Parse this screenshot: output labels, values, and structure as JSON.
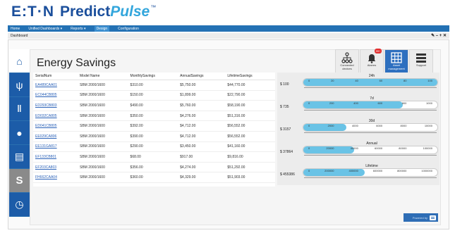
{
  "brand": {
    "company": "E:T·N",
    "product_a": "Predict",
    "product_b": "Pulse",
    "tm": "™"
  },
  "nav": {
    "items": [
      {
        "label": "Home",
        "active": false
      },
      {
        "label": "Unified Dashboards ▾",
        "active": false
      },
      {
        "label": "Reports ▾",
        "active": false
      },
      {
        "label": "Design",
        "active": true
      },
      {
        "label": "Configuration",
        "active": false
      }
    ]
  },
  "dashboard": {
    "label": "Dashboard",
    "controls": "✎ – + ✕"
  },
  "sidebar": {
    "items": [
      {
        "name": "home-icon",
        "glyph": "⌂",
        "active": true
      },
      {
        "name": "electric-plug-icon",
        "glyph": "ψ",
        "active": false
      },
      {
        "name": "thermometer-icon",
        "glyph": "Ⅱ",
        "active": false
      },
      {
        "name": "water-drop-icon",
        "glyph": "●",
        "active": false
      },
      {
        "name": "battery-icon",
        "glyph": "▤",
        "active": false
      },
      {
        "name": "s-icon",
        "glyph": "S",
        "active": false
      },
      {
        "name": "clock-icon",
        "glyph": "◷",
        "active": false
      }
    ]
  },
  "page": {
    "title": "Energy Savings"
  },
  "tiles": [
    {
      "label": "Connected devices",
      "icon": "network-icon",
      "active": false
    },
    {
      "label": "Alarms",
      "icon": "bell-icon",
      "active": false,
      "badge": "99+"
    },
    {
      "label": "Asset management",
      "icon": "grid-icon",
      "active": true
    },
    {
      "label": "Support",
      "icon": "menu-icon",
      "active": false
    }
  ],
  "table": {
    "columns": [
      "SerialNum",
      "Model Name",
      "MonthlySavings",
      "AnnualSavings",
      "LifetimeSavings"
    ],
    "rows": [
      [
        "EA489CAA01",
        "SBM 2000/1600",
        "$310.00",
        "$5,750.00",
        "$44,770.00"
      ],
      [
        "EC044CB805",
        "SBM 2000/1600",
        "$150.00",
        "$1,899.00",
        "$22,790.00"
      ],
      [
        "ED293CB803",
        "SBM 2000/1600",
        "$490.00",
        "$5,760.00",
        "$58,190.00"
      ],
      [
        "ED032CA805",
        "SBM 2000/1600",
        "$350.00",
        "$4,276.00",
        "$51,316.00"
      ],
      [
        "ED041CB805",
        "SBM 2000/1600",
        "$392.00",
        "$4,712.00",
        "$56,552.00"
      ],
      [
        "EE029CA806",
        "SBM 2000/1600",
        "$390.00",
        "$4,712.00",
        "$56,552.00"
      ],
      [
        "EE131GA817",
        "SBM 2000/1600",
        "$290.00",
        "$3,450.00",
        "$41,160.00"
      ],
      [
        "EF133CB801",
        "SBM 2000/1600",
        "$68.00",
        "$917.00",
        "$9,816.00"
      ],
      [
        "EF203CA803",
        "SBM 2000/1600",
        "$356.00",
        "$4,274.00",
        "$51,292.00"
      ],
      [
        "FH662CAA04",
        "SBM 2000/1600",
        "$360.00",
        "$4,329.00",
        "$51,903.00"
      ]
    ]
  },
  "gauges": [
    {
      "value_label": "$ 100",
      "title": "24h",
      "fill": 1.0,
      "ticks": [
        "0",
        "20",
        "40",
        "60",
        "80",
        "100"
      ]
    },
    {
      "value_label": "$ 735",
      "title": "7d",
      "fill": 0.74,
      "ticks": [
        "0",
        "200",
        "400",
        "600",
        "800",
        "1000"
      ]
    },
    {
      "value_label": "$ 3157",
      "title": "30d",
      "fill": 0.32,
      "ticks": [
        "0",
        "2000",
        "4000",
        "6000",
        "8000",
        "10000"
      ]
    },
    {
      "value_label": "$ 37864",
      "title": "Annual",
      "fill": 0.38,
      "ticks": [
        "0",
        "20000",
        "40000",
        "60000",
        "80000",
        "100000"
      ]
    },
    {
      "value_label": "$ 455386",
      "title": "Lifetime",
      "fill": 0.46,
      "ticks": [
        "0",
        "200000",
        "400000",
        "600000",
        "800000",
        "1000000"
      ]
    }
  ],
  "footer": {
    "label": "Powered by"
  },
  "colors": {
    "nav": "#2371b4",
    "sidebar": "#1c5ca8",
    "gauge_fill": "#6ac3e6",
    "tile_active": "#2d6fbf"
  }
}
